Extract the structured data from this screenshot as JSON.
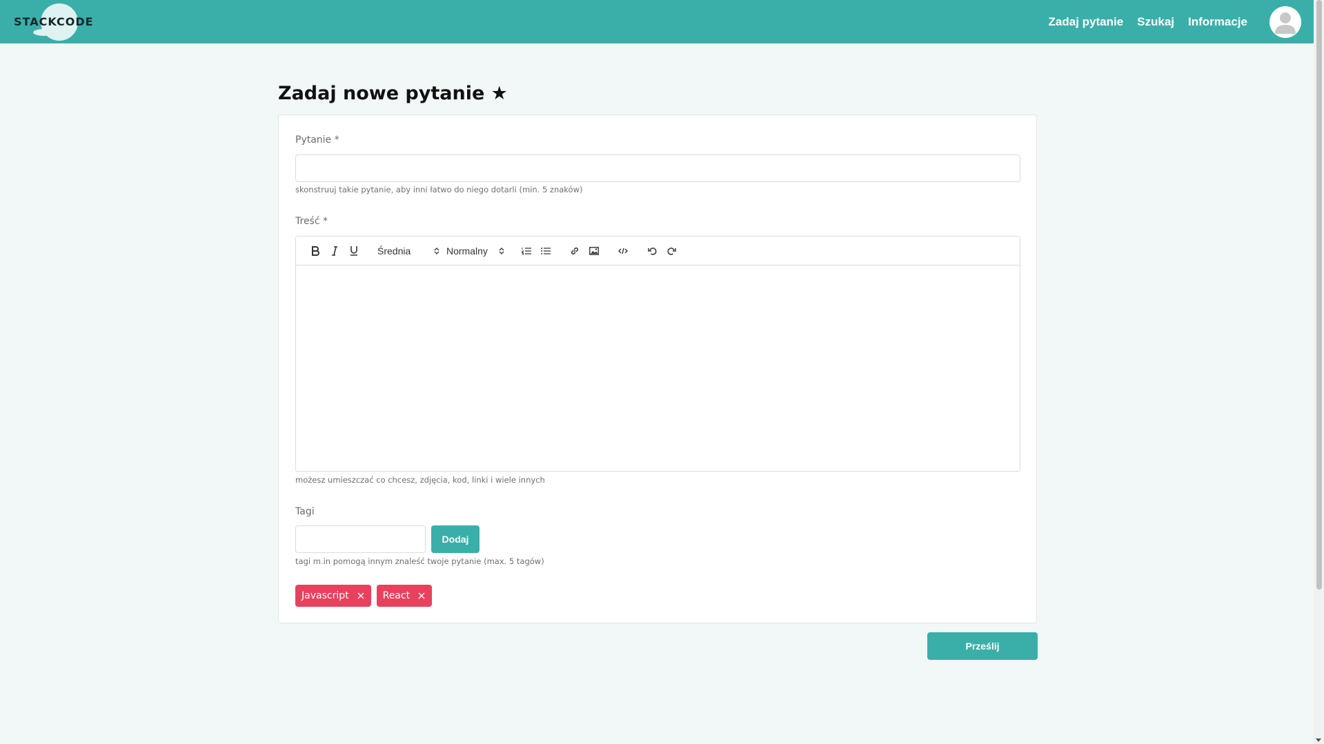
{
  "brand": {
    "logo_text": "STACKCODE"
  },
  "nav": {
    "items": [
      {
        "label": "Zadaj pytanie"
      },
      {
        "label": "Szukaj"
      },
      {
        "label": "Informacje"
      }
    ]
  },
  "page": {
    "title": "Zadaj nowe pytanie ★"
  },
  "form": {
    "question": {
      "label": "Pytanie *",
      "value": "",
      "hint": "skonstruuj takie pytanie, aby inni łatwo do niego dotarli (min. 5 znaków)"
    },
    "content": {
      "label": "Treść *",
      "hint": "możesz umieszczać co chcesz, zdjęcia, kod, linki i wiele innych",
      "toolbar": {
        "size_select": "Średnia",
        "format_select": "Normalny"
      }
    },
    "tags": {
      "label": "Tagi",
      "add_label": "Dodaj",
      "hint": "tagi m.in pomogą innym znaleść twoje pytanie (max. 5 tagów)",
      "items": [
        {
          "label": "Javascript"
        },
        {
          "label": "React"
        }
      ]
    },
    "submit_label": "Prześlij"
  },
  "colors": {
    "primary": "#3aafa9",
    "tag": "#e8415e",
    "background": "#f1f8f7"
  }
}
